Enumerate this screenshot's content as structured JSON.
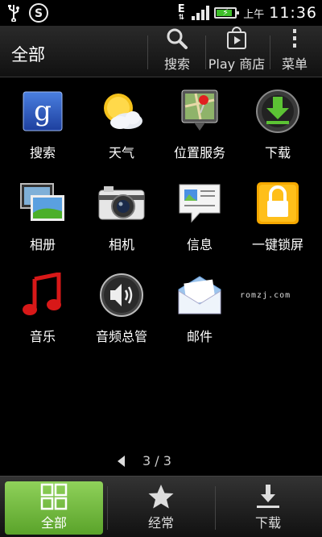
{
  "status_bar": {
    "network_type": "E",
    "ampm": "上午",
    "time": "11:36"
  },
  "action_bar": {
    "title": "全部",
    "buttons": [
      {
        "label": "搜索",
        "icon": "search-icon"
      },
      {
        "label": "Play 商店",
        "icon": "play-store-icon"
      },
      {
        "label": "菜单",
        "icon": "menu-dots-icon"
      }
    ]
  },
  "apps": [
    {
      "label": "搜索",
      "icon": "google-search-icon"
    },
    {
      "label": "天气",
      "icon": "weather-icon"
    },
    {
      "label": "位置服务",
      "icon": "location-services-icon"
    },
    {
      "label": "下载",
      "icon": "download-icon"
    },
    {
      "label": "相册",
      "icon": "gallery-icon"
    },
    {
      "label": "相机",
      "icon": "camera-icon"
    },
    {
      "label": "信息",
      "icon": "messages-icon"
    },
    {
      "label": "一键锁屏",
      "icon": "lock-screen-icon"
    },
    {
      "label": "音乐",
      "icon": "music-icon"
    },
    {
      "label": "音频总管",
      "icon": "audio-manager-icon"
    },
    {
      "label": "邮件",
      "icon": "mail-icon"
    }
  ],
  "watermark": "romzj.com",
  "pager": {
    "text": "3 / 3"
  },
  "bottom_tabs": [
    {
      "label": "全部",
      "icon": "all-apps-grid-icon",
      "active": true
    },
    {
      "label": "经常",
      "icon": "star-icon",
      "active": false
    },
    {
      "label": "下载",
      "icon": "download-tray-icon",
      "active": false
    }
  ],
  "colors": {
    "active_tab": "#7ac143",
    "battery": "#3fbf2a"
  }
}
